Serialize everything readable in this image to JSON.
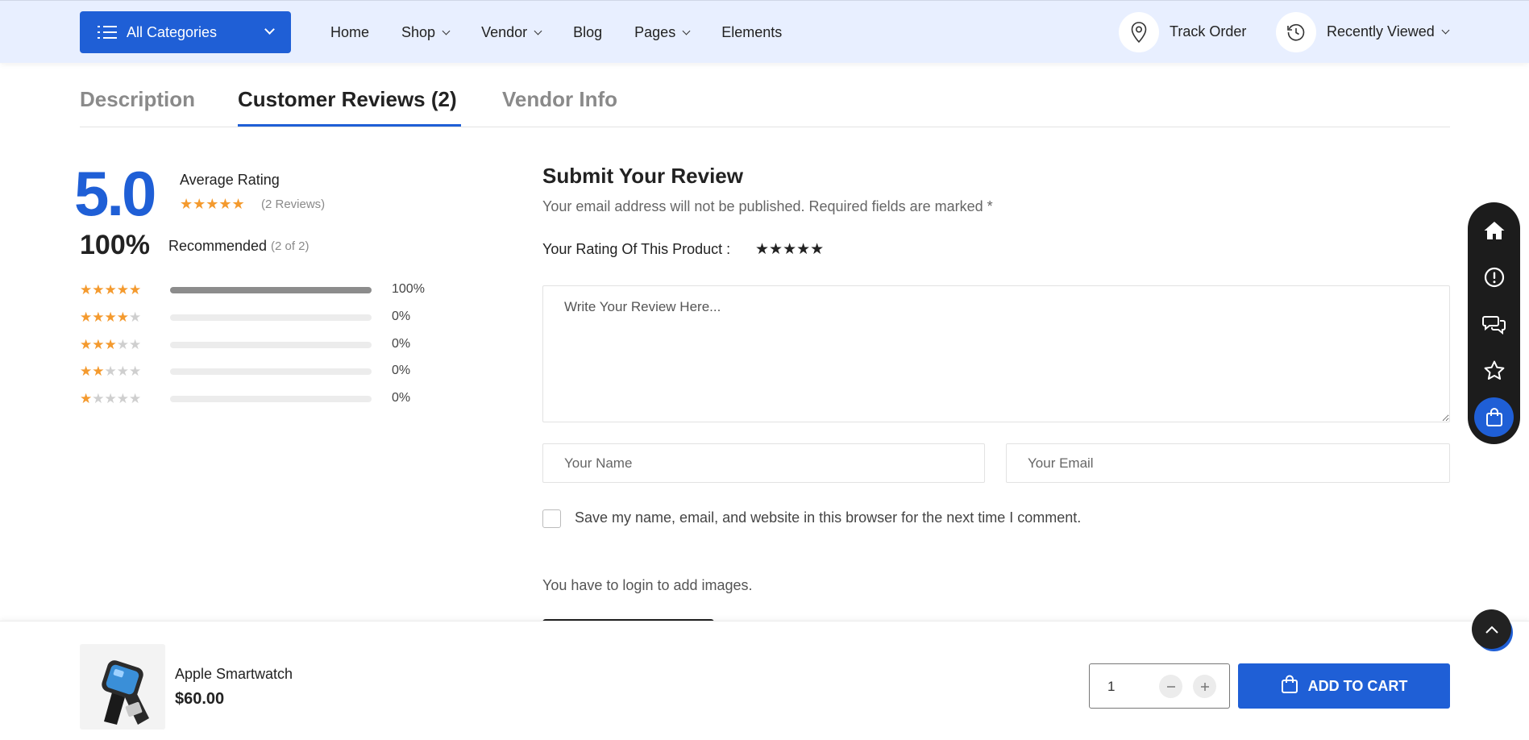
{
  "header": {
    "categories_label": "All Categories",
    "nav": [
      {
        "label": "Home",
        "dropdown": false
      },
      {
        "label": "Shop",
        "dropdown": true
      },
      {
        "label": "Vendor",
        "dropdown": true
      },
      {
        "label": "Blog",
        "dropdown": false
      },
      {
        "label": "Pages",
        "dropdown": true
      },
      {
        "label": "Elements",
        "dropdown": false
      }
    ],
    "track_order": "Track Order",
    "recently_viewed": "Recently Viewed"
  },
  "tabs": [
    {
      "label": "Description",
      "active": false
    },
    {
      "label": "Customer Reviews",
      "count": "(2)",
      "active": true
    },
    {
      "label": "Vendor Info",
      "active": false
    }
  ],
  "summary": {
    "average": "5.0",
    "average_label": "Average Rating",
    "reviews_count": "(2 Reviews)",
    "recommended_pct": "100%",
    "recommended_label": "Recommended",
    "recommended_of": "(2 of 2)",
    "breakdown": [
      {
        "stars": 5,
        "percent": "100%",
        "fraction": 1.0
      },
      {
        "stars": 4,
        "percent": "0%",
        "fraction": 0
      },
      {
        "stars": 3,
        "percent": "0%",
        "fraction": 0
      },
      {
        "stars": 2,
        "percent": "0%",
        "fraction": 0
      },
      {
        "stars": 1,
        "percent": "0%",
        "fraction": 0
      }
    ]
  },
  "form": {
    "title": "Submit Your Review",
    "subtitle": "Your email address will not be published. Required fields are marked *",
    "rating_label": "Your Rating Of This Product :",
    "review_placeholder": "Write Your Review Here...",
    "name_placeholder": "Your Name",
    "email_placeholder": "Your Email",
    "save_label": "Save my name, email, and website in this browser for the next time I comment.",
    "login_note": "You have to login to add images."
  },
  "sticky": {
    "product_name": "Apple Smartwatch",
    "price": "$60.00",
    "quantity": "1",
    "add_to_cart": "ADD TO CART"
  },
  "dock_icons": [
    "home-icon",
    "info-icon",
    "chat-icon",
    "star-icon",
    "cart-icon"
  ],
  "colors": {
    "accent": "#1f5fd6",
    "star": "#f49a2e",
    "header_bg": "#e8efff"
  }
}
